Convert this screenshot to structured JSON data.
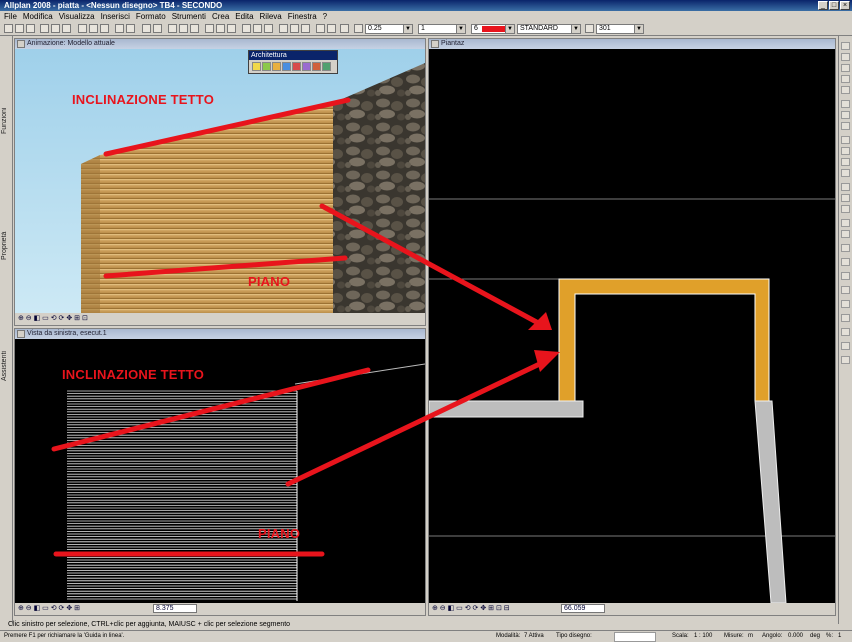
{
  "app": {
    "title": "Allplan 2008 - piatta - <Nessun disegno> TB4 - SECONDO"
  },
  "menu": [
    "File",
    "Modifica",
    "Visualizza",
    "Inserisci",
    "Formato",
    "Strumenti",
    "Crea",
    "Edita",
    "Rileva",
    "Finestra",
    "?"
  ],
  "toolbar": {
    "pen_value": "0.25",
    "line_value": "1",
    "color_value": "6",
    "layer_value": "STANDARD",
    "hatch_value": "301"
  },
  "left_tabs": [
    "Funzioni",
    "Proprietà",
    "Assistenti"
  ],
  "palette": {
    "title": "Architettura"
  },
  "panes": {
    "animation": {
      "title": "Animazione: Modello attuale",
      "zoom": ""
    },
    "side_view": {
      "title": "Vista da sinistra, esecut.1",
      "zoom": "8.375"
    },
    "plan": {
      "title": "Piantaz",
      "zoom": "66.059"
    }
  },
  "annotations": {
    "roof_slope_top": "INCLINAZIONE TETTO",
    "floor_top": "PIANO",
    "roof_slope_bottom": "INCLINAZIONE TETTO",
    "floor_bottom": "PIANO"
  },
  "colors": {
    "annotation_red": "#e8141c",
    "wall_orange": "#e0a02a",
    "wall_gray": "#bdbdbd"
  },
  "status": {
    "hint": "Clic sinistro per selezione, CTRL+clic per aggiunta, MAIUSC + clic per selezione segmento",
    "help": "Premere F1 per richiamare la 'Guida in linea'.",
    "mode_label": "Modalità:",
    "mode_value": "7 Attiva",
    "type_label": "Tipo disegno:",
    "scale_label": "Scala:",
    "scale_value": "1 : 100",
    "units_label": "Misure:",
    "units_value": "m",
    "angle_label": "Angolo:",
    "angle_value": "0.000",
    "deg_label": "deg",
    "sel_label": "%:",
    "sel_value": "1"
  }
}
